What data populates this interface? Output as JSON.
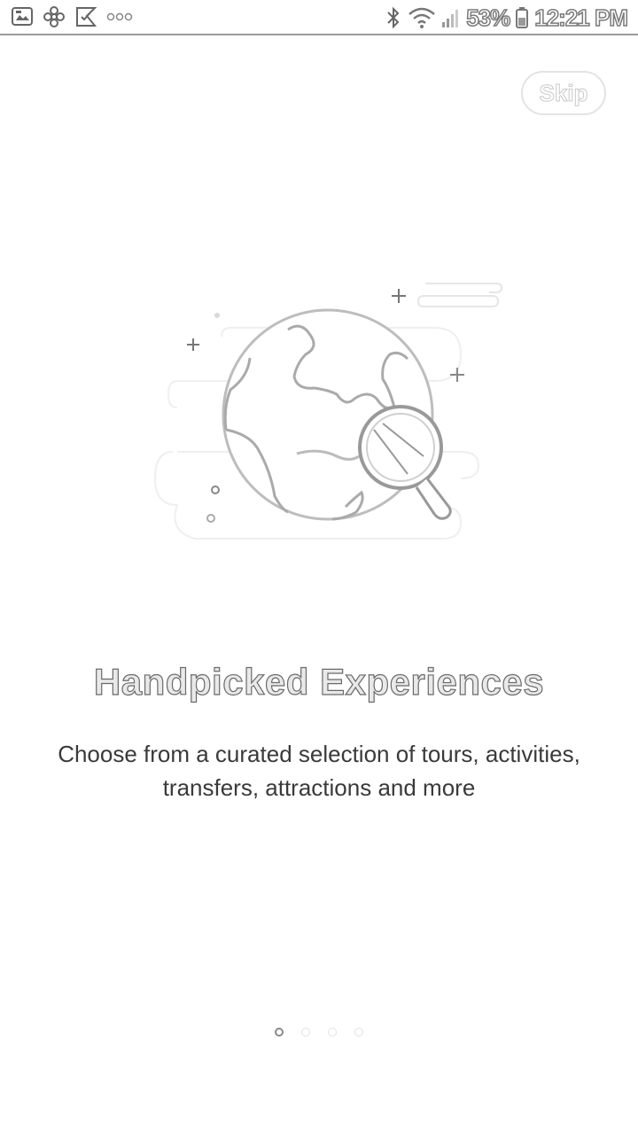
{
  "status_bar": {
    "left_icons": [
      "image-icon",
      "fan-icon",
      "chat-check-icon",
      "more-dots-icon"
    ],
    "right_icons": [
      "bluetooth-icon",
      "wifi-icon",
      "signal-icon",
      "battery-icon"
    ],
    "battery": "53%",
    "time": "12:21 PM"
  },
  "skip_label": "Skip",
  "illustration": {
    "icon": "globe-with-magnifier-icon"
  },
  "onboarding": {
    "title": "Handpicked Experiences",
    "description": "Choose from a curated selection of tours, activities, transfers, attractions and more"
  },
  "pager": {
    "total": 4,
    "current": 1
  },
  "colors": {
    "background": "#ffffff",
    "title_outline": "#6a6a6a",
    "text": "#3a3a3a",
    "dot_active": "#8a8a8a",
    "dot_inactive": "#e2e2e2"
  }
}
